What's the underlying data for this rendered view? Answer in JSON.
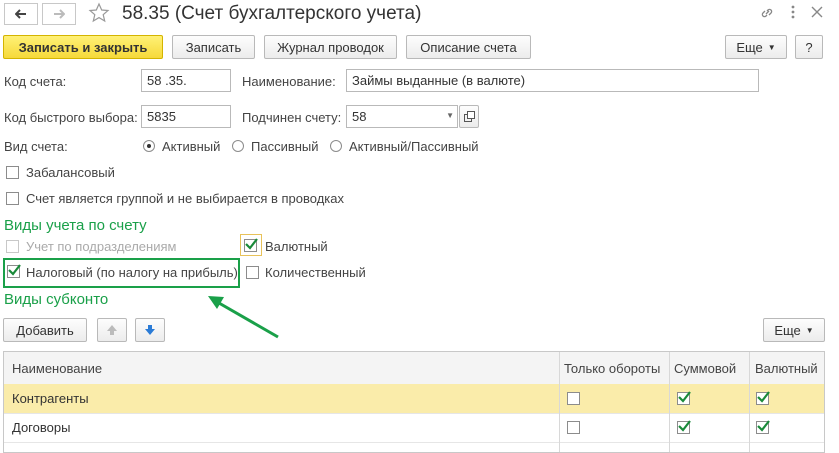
{
  "window": {
    "title": "58.35 (Счет бухгалтерского учета)"
  },
  "toolbar": {
    "save_close": "Записать и закрыть",
    "save": "Записать",
    "journal": "Журнал проводок",
    "description": "Описание счета",
    "more": "Еще",
    "help": "?"
  },
  "form": {
    "code_label": "Код счета:",
    "code_value": "58 .35.",
    "name_label": "Наименование:",
    "name_value": "Займы выданные (в валюте)",
    "quick_label": "Код быстрого выбора:",
    "quick_value": "5835",
    "parent_label": "Подчинен счету:",
    "parent_value": "58",
    "type_label": "Вид счета:",
    "type_options": [
      "Активный",
      "Пассивный",
      "Активный/Пассивный"
    ],
    "type_selected": 0,
    "offbalance_label": "Забалансовый",
    "group_label": "Счет является группой и не выбирается в проводках"
  },
  "accounting": {
    "section_title": "Виды учета по счету",
    "by_division": "Учет по подразделениям",
    "currency": "Валютный",
    "tax": "Налоговый (по налогу на прибыль)",
    "quantity": "Количественный"
  },
  "subconto": {
    "section_title": "Виды субконто",
    "add": "Добавить",
    "more": "Еще",
    "columns": [
      "Наименование",
      "Только обороты",
      "Суммовой",
      "Валютный"
    ],
    "rows": [
      {
        "name": "Контрагенты",
        "turnover": false,
        "sum": true,
        "currency": true
      },
      {
        "name": "Договоры",
        "turnover": false,
        "sum": true,
        "currency": true
      }
    ]
  },
  "colors": {
    "accent_green": "#1aa049",
    "primary_yellow": "#f6d93a",
    "selected_row": "#faecaa"
  }
}
